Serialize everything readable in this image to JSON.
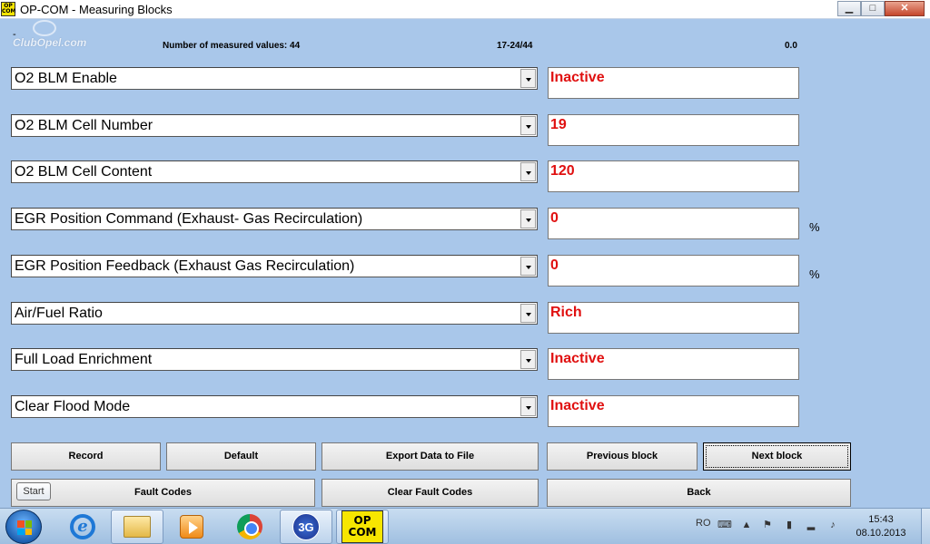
{
  "window": {
    "title": "OP-COM - Measuring Blocks",
    "icon_text_top": "OP",
    "icon_text_bottom": "COM",
    "minimize_label": "▁",
    "maximize_label": "□",
    "close_label": "✕"
  },
  "header": {
    "logo_text": "ClubOpel.com",
    "dash": "-",
    "measured_count_label": "Number of measured values: 44",
    "block_range": "17-24/44",
    "reading": "0.0"
  },
  "measurements": [
    {
      "name": "O2 BLM Enable",
      "value": "Inactive",
      "unit": ""
    },
    {
      "name": "O2 BLM Cell Number",
      "value": "19",
      "unit": ""
    },
    {
      "name": "O2 BLM Cell Content",
      "value": "120",
      "unit": ""
    },
    {
      "name": "EGR Position Command (Exhaust- Gas Recirculation)",
      "value": "0",
      "unit": "%"
    },
    {
      "name": "EGR Position Feedback (Exhaust Gas Recirculation)",
      "value": "0",
      "unit": "%"
    },
    {
      "name": "Air/Fuel Ratio",
      "value": "Rich",
      "unit": ""
    },
    {
      "name": "Full Load Enrichment",
      "value": "Inactive",
      "unit": ""
    },
    {
      "name": "Clear Flood Mode",
      "value": "Inactive",
      "unit": ""
    }
  ],
  "buttons": {
    "record": "Record",
    "default": "Default",
    "export": "Export Data to File",
    "previous": "Previous block",
    "next": "Next block",
    "fault_codes": "Fault Codes",
    "clear_fault_codes": "Clear Fault Codes",
    "back": "Back"
  },
  "tooltip": {
    "start": "Start"
  },
  "taskbar": {
    "items": [
      "Start",
      "Internet Explorer",
      "Windows Explorer",
      "Windows Media Player",
      "Google Chrome",
      "3G",
      "OP-COM"
    ],
    "g3_label": "3G",
    "opcom_top": "OP",
    "opcom_bottom": "COM",
    "language": "RO",
    "time": "15:43",
    "date": "08.10.2013"
  },
  "colors": {
    "background": "#a9c7ea",
    "value_text": "#e01010",
    "opcom_yellow": "#f7e600"
  }
}
